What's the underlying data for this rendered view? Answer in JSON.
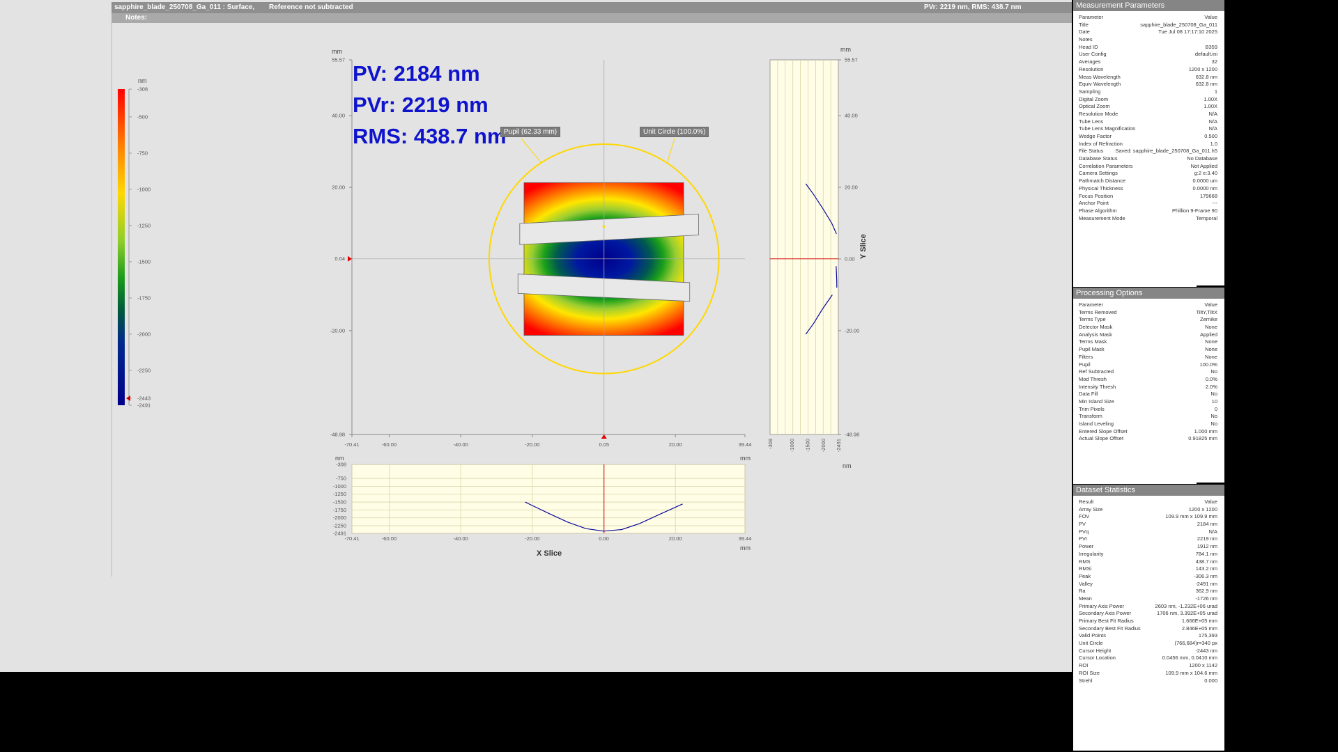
{
  "title_bar": {
    "file": "sapphire_blade_250708_Ga_011 : Surface,",
    "reference": "Reference not subtracted",
    "summary": "PVr: 2219 nm, RMS: 438.7 nm"
  },
  "notes_label": "Notes:",
  "stats_overlay": {
    "pv": "PV: 2184 nm",
    "pvr": "PVr: 2219 nm",
    "rms": "RMS: 438.7 nm"
  },
  "tags": {
    "pupil": "Pupil (62.33 mm)",
    "unit_circle": "Unit Circle (100.0%)"
  },
  "colorbar": {
    "unit": "nm",
    "ticks": [
      "-308",
      "-500",
      "-750",
      "-1000",
      "-1250",
      "-1500",
      "-1750",
      "-2000",
      "-2250",
      "-2443",
      "-2491"
    ],
    "tick_values": [
      -308,
      -500,
      -750,
      -1000,
      -1250,
      -1500,
      -1750,
      -2000,
      -2250,
      -2443,
      -2491
    ],
    "range": [
      -2491,
      -308
    ],
    "colors": [
      "#ff0000",
      "#ff7f00",
      "#ffe600",
      "#9acd32",
      "#1aa01a",
      "#006400",
      "#00288c",
      "#0000a0",
      "#00008b"
    ]
  },
  "main_plot": {
    "unit": "mm",
    "x_ticks": [
      "-70.41",
      "-60.00",
      "-40.00",
      "-20.00",
      "0.05",
      "20.00",
      "39.44"
    ],
    "x_tick_values": [
      -70.41,
      -60,
      -40,
      -20,
      0.05,
      20,
      39.44
    ],
    "x_range": [
      -70.41,
      39.44
    ],
    "y_ticks": [
      "55.57",
      "40.00",
      "20.00",
      "0.04",
      "-20.00",
      "-48.98"
    ],
    "y_tick_values": [
      55.57,
      40,
      20,
      0.04,
      -20,
      -48.98
    ],
    "y_range": [
      -48.98,
      55.57
    ],
    "cursor": {
      "x": 0.05,
      "y": 0.04
    },
    "pupil_diameter_mm": 62.33,
    "data_square": {
      "x": [
        -22.3,
        22.3
      ],
      "y": [
        -21.3,
        21.3
      ]
    },
    "masks": [
      {
        "x": [
          -23.5,
          26.5
        ],
        "y_left_top": 9.9,
        "y_left_bot": 4.0,
        "y_right_top": 12.5,
        "y_right_bot": 6.7
      },
      {
        "x": [
          -24.0,
          24.0
        ],
        "y_left_top": -4.2,
        "y_left_bot": -9.6,
        "y_right_top": -6.6,
        "y_right_bot": -11.8
      }
    ],
    "colors": {
      "pupil_circle": "#ffd700",
      "crosshair": "#aaaaaa",
      "cursor": "#e00000"
    }
  },
  "x_slice": {
    "label": "X Slice",
    "unit_top_left": "nm",
    "unit_top_right": "mm",
    "unit_bottom_right": "mm",
    "y_ticks": [
      "-308",
      "-750",
      "-1000",
      "-1250",
      "-1500",
      "-1750",
      "-2000",
      "-2250",
      "-2491"
    ],
    "y_tick_values": [
      -308,
      -750,
      -1000,
      -1250,
      -1500,
      -1750,
      -2000,
      -2250,
      -2491
    ],
    "x_ticks": [
      "-70.41",
      "-60.00",
      "-40.00",
      "-20.00",
      "0.00",
      "20.00",
      "39.44"
    ],
    "x_tick_values": [
      -70.41,
      -60,
      -40,
      -20,
      0,
      20,
      39.44
    ]
  },
  "y_slice": {
    "label": "Y Slice",
    "unit_top": "mm",
    "unit_bottom": "nm",
    "y_ticks": [
      "55.57",
      "40.00",
      "20.00",
      "0.00",
      "-20.00",
      "-48.98"
    ],
    "y_tick_values": [
      55.57,
      40,
      20,
      0,
      -20,
      -48.98
    ],
    "x_ticks": [
      "-308",
      "-1000",
      "-1500",
      "-2000",
      "-2491"
    ],
    "x_tick_values": [
      -308,
      -1000,
      -1500,
      -2000,
      -2491
    ]
  },
  "chart_data": [
    {
      "type": "line",
      "title": "X Slice",
      "xlabel": "mm",
      "ylabel": "nm",
      "xlim": [
        -70.41,
        39.44
      ],
      "ylim": [
        -2491,
        -308
      ],
      "series": [
        {
          "x": [
            -22,
            -15,
            -10,
            -5,
            0,
            5,
            10,
            15,
            22
          ],
          "values": [
            -1500,
            -1880,
            -2140,
            -2340,
            -2420,
            -2370,
            -2180,
            -1920,
            -1560
          ]
        }
      ]
    },
    {
      "type": "line",
      "title": "Y Slice",
      "xlabel": "nm",
      "ylabel": "mm",
      "xlim": [
        -308,
        -2491
      ],
      "ylim": [
        -48.98,
        55.57
      ],
      "series": [
        {
          "y": [
            21,
            18,
            14,
            10,
            7
          ],
          "values": [
            -1450,
            -1700,
            -2000,
            -2280,
            -2430
          ]
        },
        {
          "y": [
            -2,
            -4,
            -6,
            -8
          ],
          "values": [
            -2420,
            -2430,
            -2440,
            -2443
          ]
        },
        {
          "y": [
            -10,
            -14,
            -18,
            -21
          ],
          "values": [
            -2300,
            -1980,
            -1700,
            -1450
          ]
        }
      ]
    }
  ],
  "measurement_parameters": {
    "header": "Measurement Parameters",
    "rows": [
      [
        "Parameter",
        "Value"
      ],
      [
        "Title",
        "sapphire_blade_250708_Ga_011"
      ],
      [
        "Date",
        "Tue Jul 08 17:17:10 2025"
      ],
      [
        "Notes",
        ""
      ],
      [
        "Head ID",
        "B359"
      ],
      [
        "User Config",
        "default.ini"
      ],
      [
        "Averages",
        "32"
      ],
      [
        "Resolution",
        "1200 x 1200"
      ],
      [
        "Meas Wavelength",
        "632.8 nm"
      ],
      [
        "Equiv Wavelength",
        "632.8 nm"
      ],
      [
        "Sampling",
        "1"
      ],
      [
        "Digital Zoom",
        "1.00X"
      ],
      [
        "Optical Zoom",
        "1.00X"
      ],
      [
        "Resolution Mode",
        "N/A"
      ],
      [
        "Tube Lens",
        "N/A"
      ],
      [
        "Tube Lens Magnification",
        "N/A"
      ],
      [
        "Wedge Factor",
        "0.500"
      ],
      [
        "Index of Refraction",
        "1.0"
      ],
      [
        "File Status",
        "Saved: sapphire_blade_250708_Ga_011.h5"
      ],
      [
        "Database Status",
        "No Database"
      ],
      [
        "Correlation Parameters",
        "Not Applied"
      ],
      [
        "Camera Settings",
        "g:2 e:3.40"
      ],
      [
        "Pathmatch Distance",
        "0.0000 um"
      ],
      [
        "Physical Thickness",
        "0.0000 nm"
      ],
      [
        "Focus Position",
        "179668"
      ],
      [
        "Anchor Point",
        "---"
      ],
      [
        "Phase Algorithm",
        "Phillion 9-Frame 90"
      ],
      [
        "Measurement Mode",
        "Temporal"
      ]
    ]
  },
  "processing_options": {
    "header": "Processing Options",
    "rows": [
      [
        "Parameter",
        "Value"
      ],
      [
        "Terms Removed",
        "TiltY,TiltX"
      ],
      [
        "Terms Type",
        "Zernike"
      ],
      [
        "Detector Mask",
        "None"
      ],
      [
        "Analysis Mask",
        "Applied"
      ],
      [
        "Terms Mask",
        "None"
      ],
      [
        "Pupil Mask",
        "None"
      ],
      [
        "Filters",
        "None"
      ],
      [
        "Pupil",
        "100.0%"
      ],
      [
        "Ref Subtracted",
        "No"
      ],
      [
        "Mod Thresh",
        "0.0%"
      ],
      [
        "Intensity Thresh",
        "2.0%"
      ],
      [
        "Data Fill",
        "No"
      ],
      [
        "Min Island Size",
        "10"
      ],
      [
        "Trim Pixels",
        "0"
      ],
      [
        "Transform",
        "No"
      ],
      [
        "Island Leveling",
        "No"
      ],
      [
        "Entered Slope Offset",
        "1.000 mm"
      ],
      [
        "Actual Slope Offset",
        "0.91825 mm"
      ]
    ]
  },
  "dataset_statistics": {
    "header": "Dataset Statistics",
    "rows": [
      [
        "Result",
        "Value"
      ],
      [
        "Array Size",
        "1200 x 1200"
      ],
      [
        "FOV",
        "109.9 mm x 109.9 mm"
      ],
      [
        "PV",
        "2184 nm"
      ],
      [
        "PVq",
        "N/A"
      ],
      [
        "PVr",
        "2219 nm"
      ],
      [
        "Power",
        "1912 nm"
      ],
      [
        "Irregularity",
        "784.1 nm"
      ],
      [
        "RMS",
        "438.7 nm"
      ],
      [
        "RMSi",
        "143.2 nm"
      ],
      [
        "Peak",
        "-306.3 nm"
      ],
      [
        "Valley",
        "-2491 nm"
      ],
      [
        "Ra",
        "362.9 nm"
      ],
      [
        "Mean",
        "-1726 nm"
      ],
      [
        "Primary Axis Power",
        "2603 nm, -1.232E+06 urad"
      ],
      [
        "Secondary Axis Power",
        "1706 nm, 3.392E+05 urad"
      ],
      [
        "Primary Best Fit Radius",
        "1.666E+05 mm"
      ],
      [
        "Secondary Best Fit Radius",
        "2.846E+05 mm"
      ],
      [
        "Valid Points",
        "175,393"
      ],
      [
        "Unit Circle",
        "(766,684)r=340 px"
      ],
      [
        "Cursor Height",
        "-2443 nm"
      ],
      [
        "Cursor Location",
        "0.0456 mm, 0.0410 mm"
      ],
      [
        "ROI",
        "1200 x 1142"
      ],
      [
        "ROI Size",
        "109.9 mm x 104.6 mm"
      ],
      [
        "Strehl",
        "0.000"
      ]
    ]
  }
}
